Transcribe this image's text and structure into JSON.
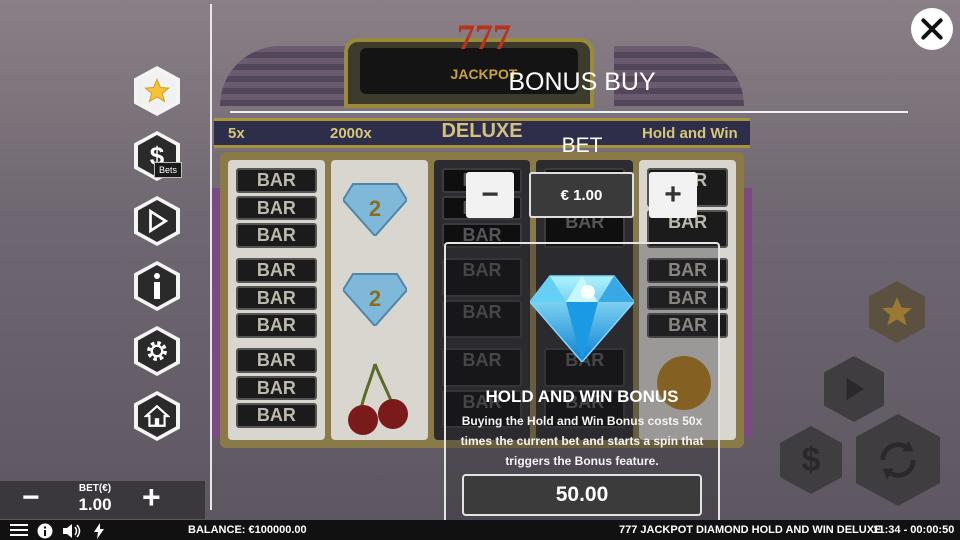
{
  "modal": {
    "title": "BONUS BUY",
    "bet_label": "BET",
    "bet_value": "€ 1.00",
    "minus_label": "−",
    "plus_label": "+",
    "bonus": {
      "title": "HOLD AND WIN BONUS",
      "description": "Buying the Hold and Win Bonus costs 50x times the current bet and starts a spin that triggers the Bonus feature.",
      "price": "50.00"
    }
  },
  "sidebar": {
    "items": [
      {
        "icon": "star-icon",
        "active": true
      },
      {
        "icon": "dollar-icon",
        "tooltip": "Bets"
      },
      {
        "icon": "play-icon"
      },
      {
        "icon": "info-icon"
      },
      {
        "icon": "gear-icon"
      },
      {
        "icon": "home-icon"
      }
    ]
  },
  "game": {
    "logo_777": "777",
    "logo_jackpot": "JACKPOT",
    "logo_deluxe": "DELUXE",
    "strip": {
      "left": "5x",
      "mid": "2000x",
      "right": "Hold and Win"
    },
    "symbol_bar": "BAR",
    "symbol_gem_value": "2"
  },
  "bet_control": {
    "label": "BET(€)",
    "value": "1.00",
    "minus": "−",
    "plus": "+"
  },
  "status_bar": {
    "balance": "BALANCE: €100000.00",
    "game_name": "777 JACKPOT DIAMOND HOLD AND WIN DELUXE",
    "time": "11:34 - 00:00:50"
  },
  "colors": {
    "accent_gold": "#f5c23a",
    "modal_white": "#ffffff",
    "status_bar": "#111111"
  }
}
